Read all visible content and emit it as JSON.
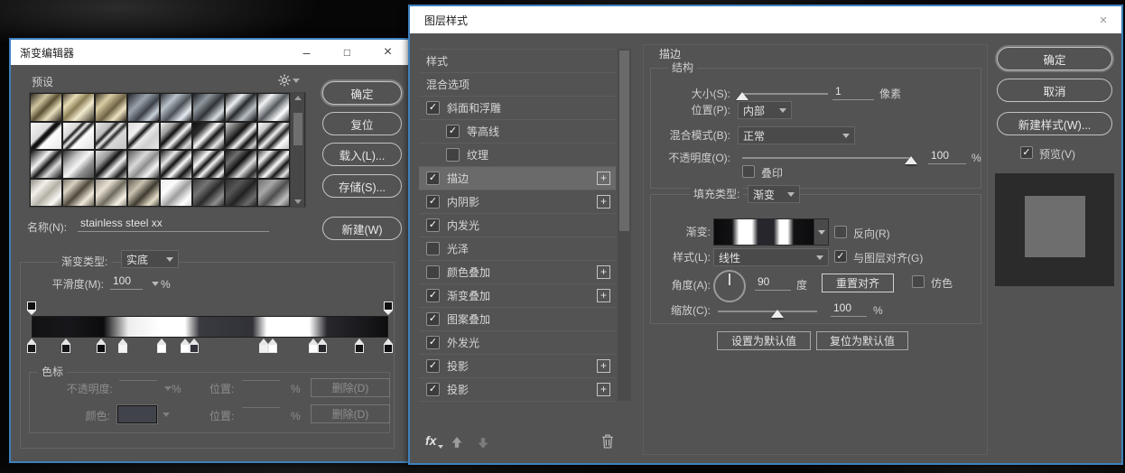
{
  "gradient_editor": {
    "title": "渐变编辑器",
    "window_buttons": {
      "minimize": "–",
      "maximize": "□",
      "close": "×"
    },
    "presets": {
      "label": "预设",
      "thumbs": [
        "linear-gradient(135deg,#2e2a20 0%,#cfc49e 30%,#5a5034 50%,#e8e0bd 70%,#241f15 100%)",
        "linear-gradient(135deg,#4a4232 0%,#e6dcb4 25%,#8a7c54 45%,#f3ecd0 65%,#3a3424 100%)",
        "linear-gradient(135deg,#3c3526 0%,#d8cda4 28%,#6e6244 55%,#efe5c4 75%,#2a2416 100%)",
        "linear-gradient(135deg,#23262b 0%,#9aa3ad 35%,#3c4148 60%,#c9d2da 80%,#16181c 100%)",
        "linear-gradient(135deg,#2b2e33 0%,#b9c2ca 30%,#4a5056 55%,#e6edf2 78%,#1b1d20 100%)",
        "linear-gradient(135deg,#191b1e 0%,#8f979e 30%,#2f3337 55%,#d7dee4 80%,#101214 100%)",
        "linear-gradient(135deg,#111214 0%,#eef1f4 30%,#26292c 50%,#b9c0c6 72%,#0c0d0f 100%)",
        "linear-gradient(135deg,#3f4246 0%,#f2f4f6 25%,#54585c 50%,#ffffff 75%,#2e3135 100%)",
        "linear-gradient(135deg,#f5f5f5 0%,#dcdcdc 38%,#111111 45%,#111111 52%,#fdfdfd 60%,#e8e8e8 100%)",
        "linear-gradient(135deg,#fafafa 0%,#d8d8d8 30%,#161616 36%,#f2f2f2 44%,#1a1a1a 52%,#fcfcfc 60%,#e0e0e0 100%)",
        "linear-gradient(135deg,#e8e8e8 0%,#bdbdbd 30%,#1c1c1c 38%,#ededed 46%,#2a2a2a 55%,#d9d9d9 64%,#c2c2c2 100%)",
        "linear-gradient(135deg,#d9d9d9 0%,#f2f2f2 30%,#141414 42%,#eaeaea 52%,#cfcfcf 70%,#e6e6e6 100%)",
        "linear-gradient(135deg,#efefef 0%,#9e9e9e 25%,#0f0f0f 40%,#f7f7f7 55%,#151515 70%,#dadada 85%,#8c8c8c 100%)",
        "linear-gradient(135deg,#101010 0%,#2c2c2c 25%,#fdfdfd 45%,#131313 60%,#e9e9e9 78%,#0d0d0d 100%)",
        "linear-gradient(135deg,#d2d2d2 0%,#616161 25%,#101010 42%,#f5f5f5 58%,#0f0f0f 72%,#cccccc 88%,#3a3a3a 100%)",
        "linear-gradient(135deg,#fbfbfb 0%,#c9c9c9 22%,#191919 34%,#f2f2f2 48%,#202020 62%,#fafafa 76%,#bfbfbf 100%)",
        "linear-gradient(135deg,#0d0d0d 0%,#f4f4f4 35%,#161616 52%,#dcdcdc 70%,#101010 100%)",
        "linear-gradient(135deg,#2c2c2c 0%,#bdbdbd 30%,#f6f6f6 50%,#8f8f8f 70%,#494949 100%)",
        "linear-gradient(135deg,#e3e3e3 0%,#9c9c9c 28%,#111111 45%,#f1f1f1 62%,#1d1d1d 82%,#cfcfcf 100%)",
        "linear-gradient(135deg,#565656 0%,#d9d9d9 35%,#8e8e8e 55%,#f3f3f3 75%,#2f2f2f 100%)",
        "linear-gradient(135deg,#161616 0%,#e9e9e9 28%,#101010 45%,#fcfcfc 60%,#141414 78%,#d6d6d6 100%)",
        "linear-gradient(135deg,#0f0f0f 0%,#fafafa 30%,#131313 44%,#f5f5f5 56%,#0e0e0e 72%,#efefef 88%,#111111 100%)",
        "linear-gradient(135deg,#1d1d1d 0%,#6f6f6f 25%,#0f0f0f 45%,#dedede 65%,#2a2a2a 85%,#969696 100%)",
        "linear-gradient(135deg,#444444 0%,#f0f0f0 22%,#111111 38%,#fdfdfd 55%,#161616 70%,#e3e3e3 86%,#2c2c2c 100%)",
        "linear-gradient(135deg,#8f8c84 0%,#f2f0ea 30%,#b4b0a6 55%,#fbfaf6 80%,#7e7b72 100%)",
        "linear-gradient(135deg,#7b746a 0%,#d9d2c2 25%,#4e483c 50%,#efe9da 75%,#6a6458 100%)",
        "linear-gradient(135deg,#9a948a 0%,#e8e2d4 30%,#6f6a5e 55%,#f6f2e6 80%,#89847a 100%)",
        "linear-gradient(135deg,#615c50 0%,#c9c2b0 30%,#3f3a30 55%,#e4ddc9 80%,#565146 100%)",
        "linear-gradient(135deg,#e9e9e9 0%,#fdfdfd 30%,#9d9d9d 55%,#ffffff 80%,#d5d5d5 100%)",
        "linear-gradient(135deg,#3a3a3a 0%,#747474 30%,#2a2a2a 55%,#8e8e8e 80%,#303030 100%)",
        "linear-gradient(135deg,#2e2e2e 0%,#565656 30%,#222222 55%,#6a6a6a 80%,#272727 100%)",
        "linear-gradient(135deg,#6e6e6e 0%,#a8a8a8 30%,#4e4e4e 55%,#bdbdbd 80%,#5c5c5c 100%)"
      ]
    },
    "buttons": {
      "ok": "确定",
      "reset": "复位",
      "load": "载入(L)...",
      "save": "存储(S)...",
      "new": "新建(W)"
    },
    "name_row": {
      "label": "名称(N):",
      "value": "stainless steel xx"
    },
    "gradient_type": {
      "label": "渐变类型:",
      "value": "实底"
    },
    "smoothness": {
      "label": "平滑度(M):",
      "value": "100",
      "unit": "%"
    },
    "gradient_bar": {
      "css": "linear-gradient(90deg,#121214 0%,#17171b 10%,#0c0c0e 20%,#ededed 27%,#ffffff 36%,#ffffff 43%,#3a3a41 47%,#313138 62%,#ffffff 66%,#ffffff 78%,#27272c 83%,#1b1b1f 92%,#0e0e10 100%)",
      "opacity_stops": [
        {
          "pos": 0
        },
        {
          "pos": 100
        }
      ],
      "color_stops": [
        {
          "pos": 0,
          "color": "#17171a"
        },
        {
          "pos": 9.5,
          "color": "#141417"
        },
        {
          "pos": 19.5,
          "color": "#0d0d0f"
        },
        {
          "pos": 25.5,
          "color": "#f4f4f4"
        },
        {
          "pos": 36.5,
          "color": "#ffffff"
        },
        {
          "pos": 43,
          "color": "#ffffff"
        },
        {
          "pos": 45.5,
          "color": "#32323a"
        },
        {
          "pos": 65,
          "color": "#f0f0f0"
        },
        {
          "pos": 67.5,
          "color": "#ffffff"
        },
        {
          "pos": 79,
          "color": "#ffffff"
        },
        {
          "pos": 81.5,
          "color": "#26262b"
        },
        {
          "pos": 92,
          "color": "#151518"
        },
        {
          "pos": 100,
          "color": "#0e0e10"
        }
      ]
    },
    "stops_section": {
      "label": "色标",
      "opacity_label": "不透明度:",
      "opacity_unit": "%",
      "position_label": "位置:",
      "position_unit": "%",
      "delete_label": "删除(D)",
      "color_label": "颜色:"
    }
  },
  "layer_style": {
    "title": "图层样式",
    "close_glyph": "×",
    "style_list": {
      "items": [
        {
          "label": "样式"
        },
        {
          "label": "混合选项"
        },
        {
          "label": "斜面和浮雕",
          "checkbox": true
        },
        {
          "label": "等高线",
          "checkbox": true,
          "indent": true
        },
        {
          "label": "纹理",
          "checkbox": false,
          "indent": true
        },
        {
          "label": "描边",
          "checkbox": true,
          "plus": true,
          "selected": true
        },
        {
          "label": "内阴影",
          "checkbox": true,
          "plus": true
        },
        {
          "label": "内发光",
          "checkbox": true
        },
        {
          "label": "光泽",
          "checkbox": false
        },
        {
          "label": "颜色叠加",
          "checkbox": false,
          "plus": true
        },
        {
          "label": "渐变叠加",
          "checkbox": true,
          "plus": true
        },
        {
          "label": "图案叠加",
          "checkbox": true
        },
        {
          "label": "外发光",
          "checkbox": true
        },
        {
          "label": "投影",
          "checkbox": true,
          "plus": true
        },
        {
          "label": "投影",
          "checkbox": true,
          "plus": true
        }
      ],
      "toolbar": {
        "fx": "fx"
      }
    },
    "stroke_panel": {
      "header": "描边",
      "structure": {
        "label": "结构",
        "size": {
          "label": "大小(S):",
          "value": "1",
          "unit": "像素"
        },
        "position": {
          "label": "位置(P):",
          "value": "内部"
        },
        "blend_mode": {
          "label": "混合模式(B):",
          "value": "正常"
        },
        "opacity": {
          "label": "不透明度(O):",
          "value": "100",
          "unit": "%"
        },
        "overprint": {
          "label": "叠印",
          "checked": false
        }
      },
      "fill": {
        "fill_type": {
          "label": "填充类型:",
          "value": "渐变"
        },
        "gradient": {
          "label": "渐变:",
          "css": "linear-gradient(90deg,#0a0a0c 0%,#121214 18%,#ffffff 25%,#ffffff 38%,#26262c 44%,#26262c 60%,#ffffff 66%,#ffffff 74%,#121214 80%,#0c0c0e 100%)"
        },
        "reverse": {
          "label": "反向(R)",
          "checked": false
        },
        "style": {
          "label": "样式(L):",
          "value": "线性"
        },
        "align_layer": {
          "label": "与图层对齐(G)",
          "checked": true
        },
        "angle": {
          "label": "角度(A):",
          "value": "90",
          "unit": "度"
        },
        "reset_align": "重置对齐",
        "dither": {
          "label": "仿色",
          "checked": false
        },
        "scale": {
          "label": "缩放(C):",
          "value": "100",
          "unit": "%"
        }
      },
      "defaults": {
        "set": "设置为默认值",
        "reset": "复位为默认值"
      }
    },
    "right_column": {
      "ok": "确定",
      "cancel": "取消",
      "new_style": "新建样式(W)...",
      "preview": {
        "label": "预览(V)",
        "checked": true
      },
      "preview_colors": {
        "outer": "#2b2b2b",
        "inner": "#6e6e6e"
      }
    }
  }
}
